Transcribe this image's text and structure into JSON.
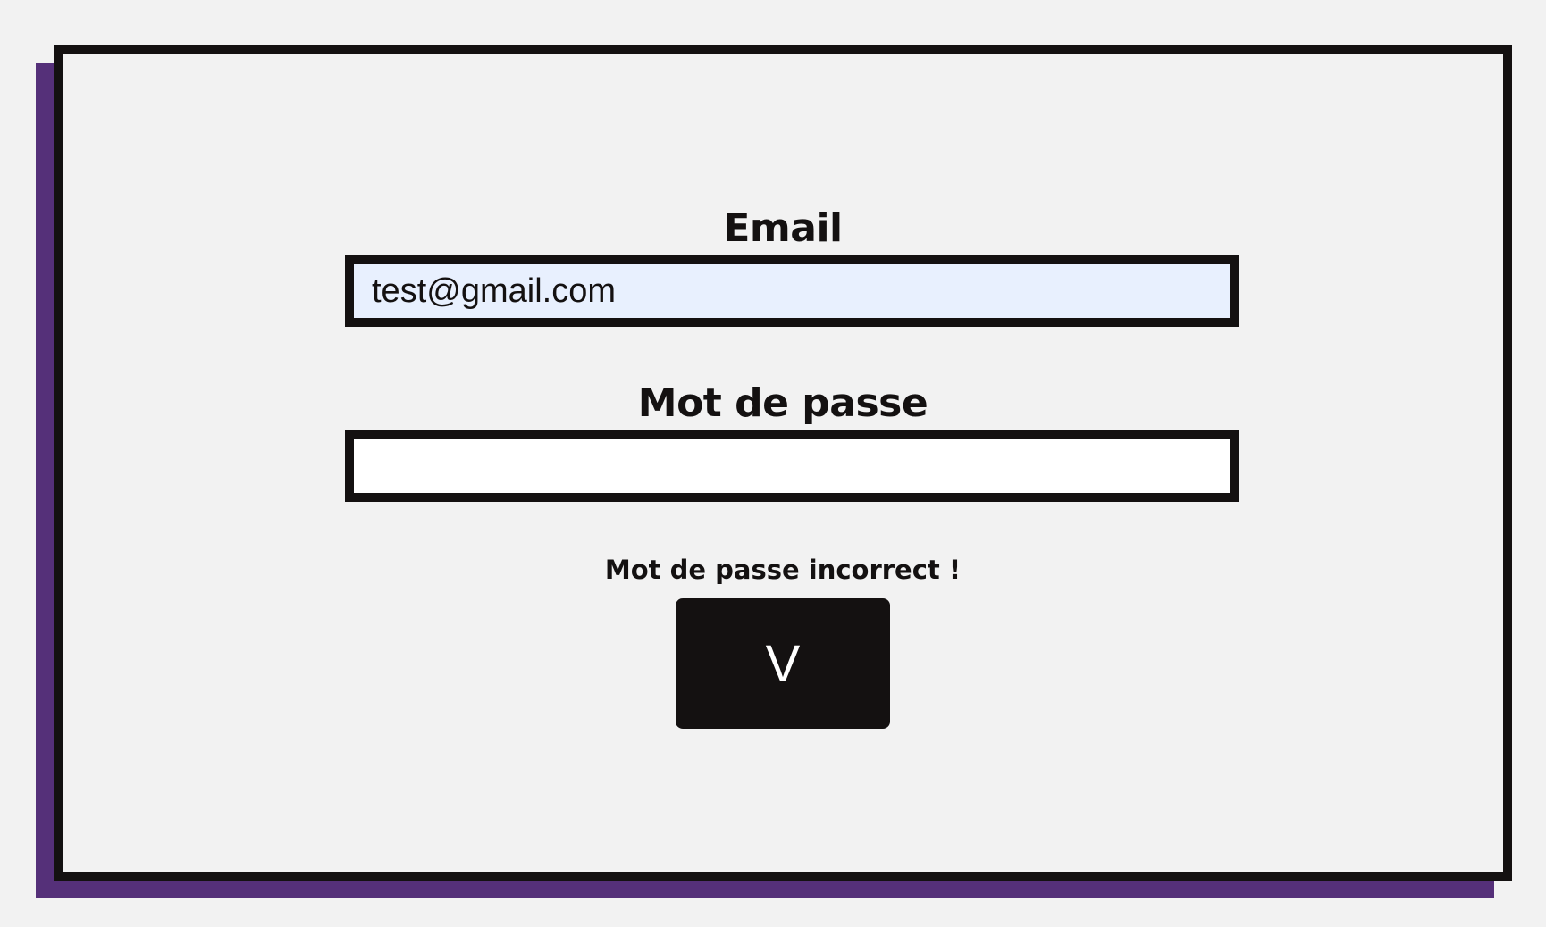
{
  "form": {
    "email_label": "Email",
    "email_value": "test@gmail.com",
    "password_label": "Mot de passe",
    "password_value": "",
    "error_message": "Mot de passe incorrect !",
    "submit_label": "V"
  },
  "colors": {
    "background": "#f2f2f2",
    "panel_border": "#141111",
    "shadow": "#553079",
    "email_input_bg": "#e8f0fe",
    "password_input_bg": "#ffffff",
    "button_bg": "#141111",
    "button_text": "#ffffff"
  }
}
